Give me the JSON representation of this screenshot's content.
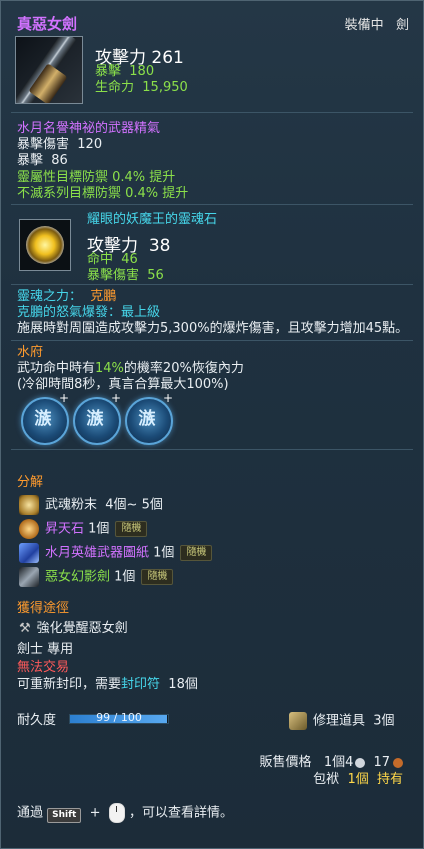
{
  "item": {
    "name": "真惡女劍",
    "equip_status": "裝備中",
    "equip_type": "劍",
    "attack_label": "攻擊力",
    "attack_value": "261",
    "crit_label": "暴擊",
    "crit_value": "180",
    "hp_label": "生命力",
    "hp_value": "15,950"
  },
  "essence": {
    "title": "水月名譽神祕的武器精氣",
    "line1_label": "暴擊傷害",
    "line1_value": "120",
    "line2_label": "暴擊",
    "line2_value": "86",
    "line3": "靈屬性目標防禦 0.4% 提升",
    "line4": "不滅系列目標防禦 0.4% 提升"
  },
  "soul": {
    "title": "耀眼的妖魔王的靈魂石",
    "attack_label": "攻擊力",
    "attack_value": "38",
    "hit_label": "命中",
    "hit_value": "46",
    "critdmg_label": "暴擊傷害",
    "critdmg_value": "56"
  },
  "soul_power": {
    "label": "靈魂之力：",
    "name": "克鵬",
    "rage_line": "克鵬的怒氣爆發：最上級",
    "desc": "施展時對周圍造成攻擊力5,300%的爆炸傷害，且攻擊力增加45點。"
  },
  "effect": {
    "name": "水府",
    "line1_pre": "武功命中時有",
    "line1_pct": "14%",
    "line1_post": "的機率20%恢復內力",
    "line2": "(冷卻時間8秒，真言合算最大100%)"
  },
  "slots": [
    {
      "symbol": "㵀",
      "mark": "+"
    },
    {
      "symbol": "㵀",
      "mark": "+"
    },
    {
      "symbol": "㵀",
      "mark": "+"
    }
  ],
  "decompose": {
    "title": "分解",
    "items": [
      {
        "name": "武魂粉末",
        "qty": "4個~ 5個",
        "tag": "",
        "icon": "dust-icon",
        "color": "#e9eef2"
      },
      {
        "name": "昇天石",
        "qty": "1個",
        "tag": "隨機",
        "icon": "ascension-stone-icon",
        "color": "#d272ff"
      },
      {
        "name": "水月英雄武器圖紙",
        "qty": "1個",
        "tag": "隨機",
        "icon": "blueprint-icon",
        "color": "#d272ff"
      },
      {
        "name": "惡女幻影劍",
        "qty": "1個",
        "tag": "隨機",
        "icon": "sword-icon",
        "color": "#8be04a"
      }
    ]
  },
  "acquire": {
    "title": "獲得途徑",
    "method": "強化覺醒惡女劍",
    "class_req": "劍士 專用",
    "trade": "無法交易",
    "reseal_pre": "可重新封印，需要",
    "reseal_item": "封印符",
    "reseal_qty": "18個"
  },
  "durability": {
    "label": "耐久度",
    "current": "99",
    "separator": "/",
    "max": "100",
    "fill_pct": 99,
    "repair_label": "修理道具",
    "repair_qty": "3個"
  },
  "price": {
    "label": "販售價格",
    "qty_prefix": "1個",
    "silver": "4",
    "copper": "17",
    "bag_label": "包袱",
    "bag_qty": "1個",
    "bag_suffix": "持有"
  },
  "footer": {
    "pre": "通過",
    "key": "Shift",
    "plus": "+",
    "post": "，可以查看詳情。"
  }
}
